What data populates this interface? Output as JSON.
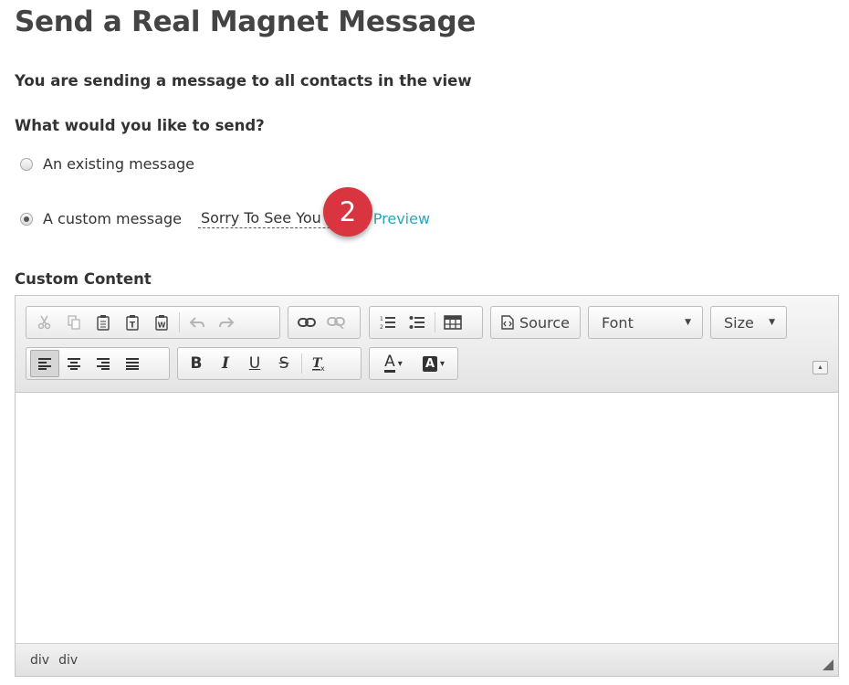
{
  "page_title": "Send a Real Magnet Message",
  "info_text": "You are sending a message to all contacts in the view",
  "question_label": "What would you like to send?",
  "options": {
    "existing": "An existing message",
    "custom": "A custom message"
  },
  "selected_message": "Sorry To See You",
  "preview_link": "Preview",
  "step_badge": "2",
  "section_label": "Custom Content",
  "toolbar": {
    "source_label": "Source",
    "font_label": "Font",
    "size_label": "Size",
    "bold_glyph": "B",
    "italic_glyph": "I",
    "underline_glyph": "U",
    "strike_glyph": "S",
    "text_color_glyph": "A",
    "bg_color_glyph": "A"
  },
  "status_bar": [
    "div",
    "div"
  ],
  "colors": {
    "accent_link": "#2aa6b8",
    "badge": "#d93540"
  }
}
